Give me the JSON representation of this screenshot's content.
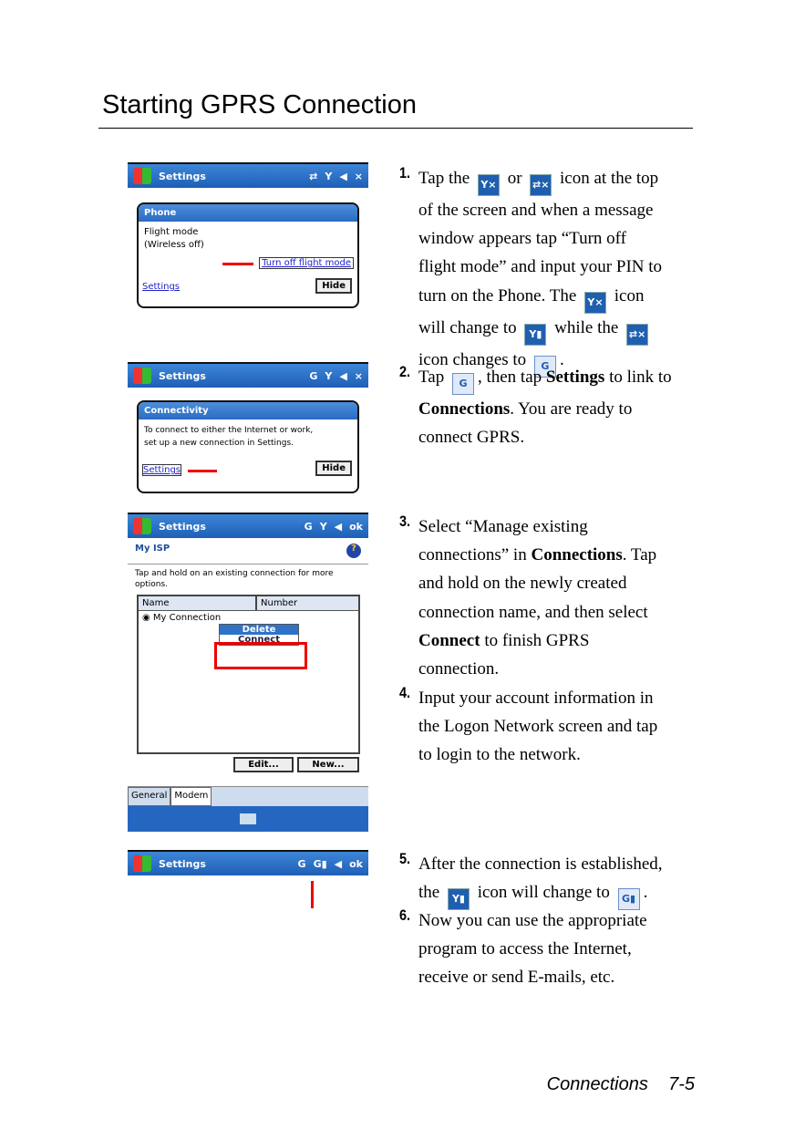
{
  "page": {
    "title": "Starting GPRS Connection",
    "footer_section": "Connections",
    "footer_page": "7-5"
  },
  "steps": [
    {
      "n": "1.",
      "lines": [
        [
          {
            "t": "Tap the "
          },
          {
            "icon": "phone-off-icon"
          },
          {
            "t": " or "
          },
          {
            "icon": "connectivity-off-icon"
          },
          {
            "t": " icon at the top"
          }
        ],
        [
          {
            "t": "of the screen and when a message"
          }
        ],
        [
          {
            "t": "window appears tap “Turn off"
          }
        ],
        [
          {
            "t": "flight mode” and input your PIN to"
          }
        ],
        [
          {
            "t": "turn on the Phone. The "
          },
          {
            "icon": "phone-off-icon"
          },
          {
            "t": " icon"
          }
        ],
        [
          {
            "t": "will change to "
          },
          {
            "icon": "signal-icon"
          },
          {
            "t": " while the "
          },
          {
            "icon": "connectivity-off-icon"
          }
        ],
        [
          {
            "t": "icon changes to "
          },
          {
            "icon": "gprs-icon"
          },
          {
            "t": "."
          }
        ]
      ]
    },
    {
      "n": "2.",
      "lines": [
        [
          {
            "t": "Tap "
          },
          {
            "icon": "gprs-icon"
          },
          {
            "t": ", then tap "
          },
          {
            "b": "Settings"
          },
          {
            "t": " to link to"
          }
        ],
        [
          {
            "b": "Connections"
          },
          {
            "t": ". You are ready to"
          }
        ],
        [
          {
            "t": "connect GPRS."
          }
        ]
      ]
    },
    {
      "n": "3.",
      "lines": [
        [
          {
            "t": "Select “Manage existing"
          }
        ],
        [
          {
            "t": "connections” in "
          },
          {
            "b": "Connections"
          },
          {
            "t": ". Tap"
          }
        ],
        [
          {
            "t": "and hold on the newly created"
          }
        ],
        [
          {
            "t": "connection name, and then select"
          }
        ],
        [
          {
            "b": "Connect"
          },
          {
            "t": " to finish GPRS"
          }
        ],
        [
          {
            "t": "connection."
          }
        ]
      ]
    },
    {
      "n": "4.",
      "lines": [
        [
          {
            "t": "Input your account information in"
          }
        ],
        [
          {
            "t": "the Logon Network screen and tap"
          }
        ],
        [
          {
            "t": "to login to the network."
          }
        ]
      ]
    },
    {
      "n": "5.",
      "lines": [
        [
          {
            "t": "After the connection is established,"
          }
        ],
        [
          {
            "t": "the "
          },
          {
            "icon": "signal-icon"
          },
          {
            "t": " icon will change to "
          },
          {
            "icon": "gprs-signal-icon"
          },
          {
            "t": "."
          }
        ]
      ]
    },
    {
      "n": "6.",
      "lines": [
        [
          {
            "t": "Now you can use the appropriate"
          }
        ],
        [
          {
            "t": "program to access the Internet,"
          }
        ],
        [
          {
            "t": "receive or send E-mails, etc."
          }
        ]
      ]
    }
  ],
  "icon_glyphs": {
    "phone-off-icon": "Y×",
    "connectivity-off-icon": "⇄×",
    "signal-icon": "Y▮",
    "gprs-icon": "G",
    "gprs-signal-icon": "G▮"
  },
  "shots": {
    "app_title": "Settings",
    "s1": {
      "header": "Phone",
      "line1": "Flight mode",
      "line2": "(Wireless off)",
      "link": "Turn off flight mode",
      "settings": "Settings",
      "hide": "Hide"
    },
    "s2": {
      "header": "Connectivity",
      "line1": "To connect to either the Internet or work,",
      "line2": "set up a new connection in Settings.",
      "settings": "Settings",
      "hide": "Hide"
    },
    "s3": {
      "heading": "My ISP",
      "help": "?",
      "info": "Tap and hold on an existing connection for more options.",
      "col_name": "Name",
      "col_number": "Number",
      "row": "My Connection",
      "menu_delete": "Delete",
      "menu_connect": "Connect",
      "edit": "Edit...",
      "new": "New...",
      "tab_general": "General",
      "tab_modem": "Modem",
      "ok": "ok"
    },
    "close": "×"
  },
  "colors": {
    "accent_red": "#e00000",
    "title_bar": "#1e5fb6"
  }
}
